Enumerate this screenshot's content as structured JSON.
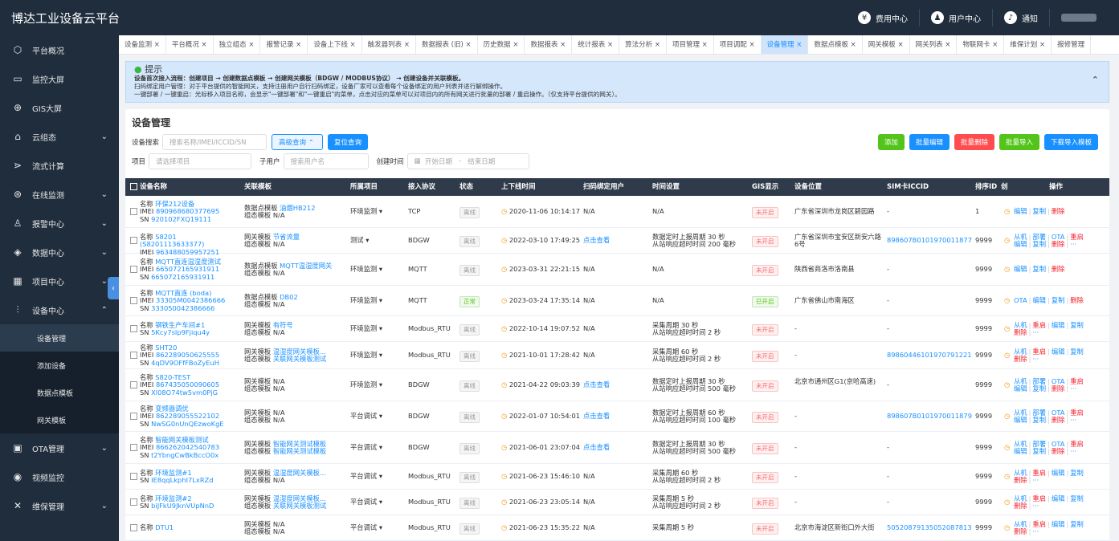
{
  "header": {
    "title": "博达工业设备云平台",
    "fee": "费用中心",
    "user": "用户中心",
    "notice": "通知"
  },
  "sidebar": {
    "items": [
      {
        "icon": "⬡",
        "label": "平台概况",
        "chev": ""
      },
      {
        "icon": "▭",
        "label": "监控大屏",
        "chev": ""
      },
      {
        "icon": "⊕",
        "label": "GIS大屏",
        "chev": ""
      },
      {
        "icon": "⌂",
        "label": "云组态",
        "chev": "⌄"
      },
      {
        "icon": "⋗",
        "label": "流式计算",
        "chev": ""
      },
      {
        "icon": "⊛",
        "label": "在线监测",
        "chev": "⌄"
      },
      {
        "icon": "♙",
        "label": "报警中心",
        "chev": "⌄"
      },
      {
        "icon": "◈",
        "label": "数据中心",
        "chev": "⌄"
      },
      {
        "icon": "▦",
        "label": "项目中心",
        "chev": "⌄"
      },
      {
        "icon": "⫶",
        "label": "设备中心",
        "chev": "⌃"
      }
    ],
    "subs": [
      "设备管理",
      "添加设备",
      "数据点模板",
      "网关模板"
    ],
    "bottom": [
      {
        "icon": "▣",
        "label": "OTA管理",
        "chev": "⌄"
      },
      {
        "icon": "◉",
        "label": "视频监控",
        "chev": ""
      },
      {
        "icon": "✕",
        "label": "维保管理",
        "chev": "⌄"
      }
    ]
  },
  "tabs": [
    "设备监测 ×",
    "平台概况 ×",
    "独立组态 ×",
    "报警记录 ×",
    "设备上下线 ×",
    "触发器列表 ×",
    "数据报表 (旧) ×",
    "历史数据 ×",
    "数据报表 ×",
    "统计报表 ×",
    "算法分析 ×",
    "项目管理 ×",
    "项目调配 ×",
    "设备管理 ×",
    "数据点模板 ×",
    "网关模板 ×",
    "网关列表 ×",
    "物联网卡 ×",
    "维保计划 ×",
    "报修管理"
  ],
  "tip": {
    "title": "提示",
    "l1": "设备首次接入流程：创建项目 → 创建数据点模板 → 创建网关模板（BDGW / MODBUS协议） → 创建设备并关联模板。",
    "l2": "扫码绑定用户管理：对于平台提供的智能网关，支持注册用户自行扫码绑定，设备厂家可以查看每个设备绑定的用户列表并进行解绑操作。",
    "l3": "一键部署 / 一键重启：光标移入项目名称，会显示\"一键部署\"和\"一键重启\"的菜单，点击对应的菜单可以对项目内的所有网关进行批量的部署 / 重启操作。（仅支持平台提供的网关）。"
  },
  "main": {
    "title": "设备管理",
    "search_label": "设备搜索",
    "search_ph": "搜索名称/IMEI/ICCID/SN",
    "adv": "高级查询 ⌃",
    "reset": "复位查询",
    "project_label": "项目",
    "project_ph": "请选择项目",
    "sub_label": "子用户",
    "sub_ph": "搜索用户名",
    "time_label": "创建时间",
    "start": "开始日期",
    "dash": "-",
    "end": "结束日期",
    "btns": [
      "添加",
      "批量编辑",
      "批量删除",
      "批量导入",
      "下载导入模板"
    ]
  },
  "cols": [
    "设备名称",
    "关联模板",
    "所属项目",
    "接入协议",
    "状态",
    "上下线时间",
    "扫码绑定用户",
    "时间设置",
    "GIS显示",
    "设备位置",
    "SIM卡ICCID",
    "排序ID",
    "创",
    "操作"
  ],
  "rows": [
    {
      "name": "环保212设备",
      "imei": "890968680377695",
      "sn": "920102FXQ19111",
      "t1": "数据点模板",
      "t1v": "油烟HB212",
      "t2": "组态模板",
      "t2v": "N/A",
      "proj": "环境监测",
      "proto": "TCP",
      "st": "离线",
      "time": "2020-11-06 10:14:17",
      "bind": "N/A",
      "ts1": "N/A",
      "ts2": "",
      "gis": "未开启",
      "loc": "广东省深圳市龙岗区碧园路",
      "sim": "-",
      "sort": "1",
      "ops": [
        "编辑",
        "复制",
        "删除"
      ]
    },
    {
      "name": "S8201 (S8201113633377)",
      "imei": "963488059957251",
      "sn": "",
      "t1": "网关模板",
      "t1v": "节省流量",
      "t2": "组态模板",
      "t2v": "N/A",
      "proj": "测试",
      "proto": "BDGW",
      "st": "离线",
      "time": "2022-03-10 17:49:25",
      "bind": "点击查看",
      "ts1": "数据定时上报周期 30 秒",
      "ts2": "从站响应超时时间 200 毫秒",
      "gis": "未开启",
      "loc": "广东省深圳市宝安区新安六路6号",
      "sim": "898607B0101970011877",
      "sort": "9999",
      "ops": [
        "从机",
        "部署",
        "OTA",
        "重启",
        "编辑",
        "复制",
        "删除",
        "···"
      ]
    },
    {
      "name": "MQTT直连温湿度测试",
      "imei": "665072165931911",
      "sn": "665072165931911",
      "t1": "数据点模板",
      "t1v": "MQTT温湿度网关",
      "t2": "组态模板",
      "t2v": "N/A",
      "proj": "环境监测",
      "proto": "MQTT",
      "st": "离线",
      "time": "2023-03-31 22:21:15",
      "bind": "N/A",
      "ts1": "N/A",
      "ts2": "",
      "gis": "未开启",
      "loc": "陕西省商洛市洛南县",
      "sim": "-",
      "sort": "9999",
      "ops": [
        "编辑",
        "复制",
        "删除"
      ]
    },
    {
      "name": "MQTT直连 (boda)",
      "imei": "33305M0042386666",
      "sn": "333050042386666",
      "t1": "数据点模板",
      "t1v": "DB02",
      "t2": "组态模板",
      "t2v": "N/A",
      "proj": "环境监测",
      "proto": "MQTT",
      "st": "正常",
      "time": "2023-03-24 17:35:14",
      "bind": "N/A",
      "ts1": "N/A",
      "ts2": "",
      "gis": "已开启",
      "loc": "广东省佛山市南海区",
      "sim": "-",
      "sort": "9999",
      "ops": [
        "OTA",
        "编辑",
        "复制",
        "删除"
      ]
    },
    {
      "name": "钢铁生产车间#1",
      "imei": "",
      "sn": "5Kcy7sIp9Fjiqu4y",
      "t1": "网关模板",
      "t1v": "有符号",
      "t2": "组态模板",
      "t2v": "N/A",
      "proj": "环境监测",
      "proto": "Modbus_RTU",
      "st": "离线",
      "time": "2022-10-14 19:07:52",
      "bind": "N/A",
      "ts1": "采集周期 30 秒",
      "ts2": "从站响应超时时间 2 秒",
      "gis": "未开启",
      "loc": "-",
      "sim": "-",
      "sort": "9999",
      "ops": [
        "从机",
        "重启",
        "编辑",
        "复制",
        "删除",
        "···"
      ]
    },
    {
      "name": "SHT20",
      "imei": "862289050625555",
      "sn": "4qDV9OFfFBoZyEuH",
      "t1": "网关模板",
      "t1v": "温湿度网关模板...",
      "t2": "组态模板",
      "t2v": "关联网关模板测试",
      "proj": "环境监测",
      "proto": "Modbus_RTU",
      "st": "离线",
      "time": "2021-10-01 17:28:42",
      "bind": "N/A",
      "ts1": "采集周期 60 秒",
      "ts2": "从站响应超时时间 2 秒",
      "gis": "未开启",
      "loc": "-",
      "sim": "89860446101970791221",
      "sort": "9999",
      "ops": [
        "从机",
        "重启",
        "编辑",
        "复制",
        "删除",
        "···"
      ]
    },
    {
      "name": "S820-TEST",
      "imei": "867435050090605",
      "sn": "Xl08O74tw5vm0PjG",
      "t1": "网关模板",
      "t1v": "N/A",
      "t2": "组态模板",
      "t2v": "N/A",
      "proj": "环境监测",
      "proto": "BDGW",
      "st": "离线",
      "time": "2021-04-22 09:03:39",
      "bind": "点击查看",
      "ts1": "数据定时上报周期 30 秒",
      "ts2": "从站响应超时时间 500 毫秒",
      "gis": "未开启",
      "loc": "北京市通州区G1(京哈高速)",
      "sim": "-",
      "sort": "9999",
      "ops": [
        "从机",
        "部署",
        "OTA",
        "重启",
        "编辑",
        "复制",
        "删除",
        "···"
      ]
    },
    {
      "name": "变频器调优",
      "imei": "862289055522102",
      "sn": "NwSG0nUnQEzwoKgE",
      "t1": "网关模板",
      "t1v": "N/A",
      "t2": "组态模板",
      "t2v": "N/A",
      "proj": "平台调试",
      "proto": "BDGW",
      "st": "离线",
      "time": "2022-01-07 10:54:01",
      "bind": "点击查看",
      "ts1": "数据定时上报周期 60 秒",
      "ts2": "从站响应超时时间 100 毫秒",
      "gis": "未开启",
      "loc": "-",
      "sim": "898607B0101970011879",
      "sort": "9999",
      "ops": [
        "从机",
        "部署",
        "OTA",
        "重启",
        "编辑",
        "复制",
        "删除",
        "···"
      ]
    },
    {
      "name": "智能网关模板测试",
      "imei": "866262042540783",
      "sn": "t2YbngCwBkBccO0x",
      "t1": "网关模板",
      "t1v": "智能网关测试模板",
      "t2": "组态模板",
      "t2v": "智能网关测试模板",
      "proj": "平台调试",
      "proto": "BDGW",
      "st": "离线",
      "time": "2021-06-01 23:07:04",
      "bind": "点击查看",
      "ts1": "数据定时上报周期 30 秒",
      "ts2": "从站响应超时时间 500 毫秒",
      "gis": "未开启",
      "loc": "-",
      "sim": "-",
      "sort": "9999",
      "ops": [
        "从机",
        "部署",
        "OTA",
        "重启",
        "编辑",
        "复制",
        "删除",
        "···"
      ]
    },
    {
      "name": "环境监测#1",
      "imei": "",
      "sn": "IE8qqLkphI7LxRZd",
      "t1": "网关模板",
      "t1v": "温湿度网关模板...",
      "t2": "组态模板",
      "t2v": "N/A",
      "proj": "平台调试",
      "proto": "Modbus_RTU",
      "st": "离线",
      "time": "2021-06-23 15:46:10",
      "bind": "N/A",
      "ts1": "采集周期 60 秒",
      "ts2": "从站响应超时时间 2 秒",
      "gis": "未开启",
      "loc": "-",
      "sim": "-",
      "sort": "9999",
      "ops": [
        "从机",
        "重启",
        "编辑",
        "复制",
        "删除",
        "···"
      ]
    },
    {
      "name": "环境监测#2",
      "imei": "",
      "sn": "biJFkU9JknVUpNnD",
      "t1": "网关模板",
      "t1v": "温湿度网关模板...",
      "t2": "组态模板",
      "t2v": "关联网关模板测试",
      "proj": "平台调试",
      "proto": "Modbus_RTU",
      "st": "离线",
      "time": "2021-06-23 23:05:14",
      "bind": "N/A",
      "ts1": "采集周期 5 秒",
      "ts2": "从站响应超时时间 2 秒",
      "gis": "未开启",
      "loc": "-",
      "sim": "-",
      "sort": "9999",
      "ops": [
        "从机",
        "重启",
        "编辑",
        "复制",
        "删除",
        "···"
      ]
    },
    {
      "name": "DTU1",
      "imei": "",
      "sn": "",
      "t1": "网关模板",
      "t1v": "N/A",
      "t2": "组态模板",
      "t2v": "N/A",
      "proj": "平台调试",
      "proto": "Modbus_RTU",
      "st": "离线",
      "time": "2021-06-23 15:35:22",
      "bind": "N/A",
      "ts1": "采集周期 5 秒",
      "ts2": "",
      "gis": "未开启",
      "loc": "北京市海淀区新街口外大街",
      "sim": "50520879135052087813",
      "sort": "9999",
      "ops": [
        "从机",
        "重启",
        "编辑",
        "复制",
        "删除",
        "···"
      ]
    }
  ]
}
